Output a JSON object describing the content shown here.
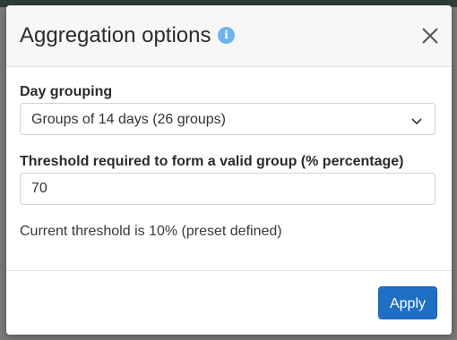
{
  "modal": {
    "title": "Aggregation options",
    "info_icon": "info-icon",
    "close_icon": "close-icon"
  },
  "day_grouping": {
    "label": "Day grouping",
    "selected": "Groups of 14 days (26 groups)"
  },
  "threshold": {
    "label": "Threshold required to form a valid group (% percentage)",
    "value": "70"
  },
  "help_text": "Current threshold is 10% (preset defined)",
  "footer": {
    "apply_label": "Apply"
  },
  "colors": {
    "primary": "#1f6fc5",
    "info": "#6cb4f0",
    "header_bg": "#f7f7f8"
  }
}
